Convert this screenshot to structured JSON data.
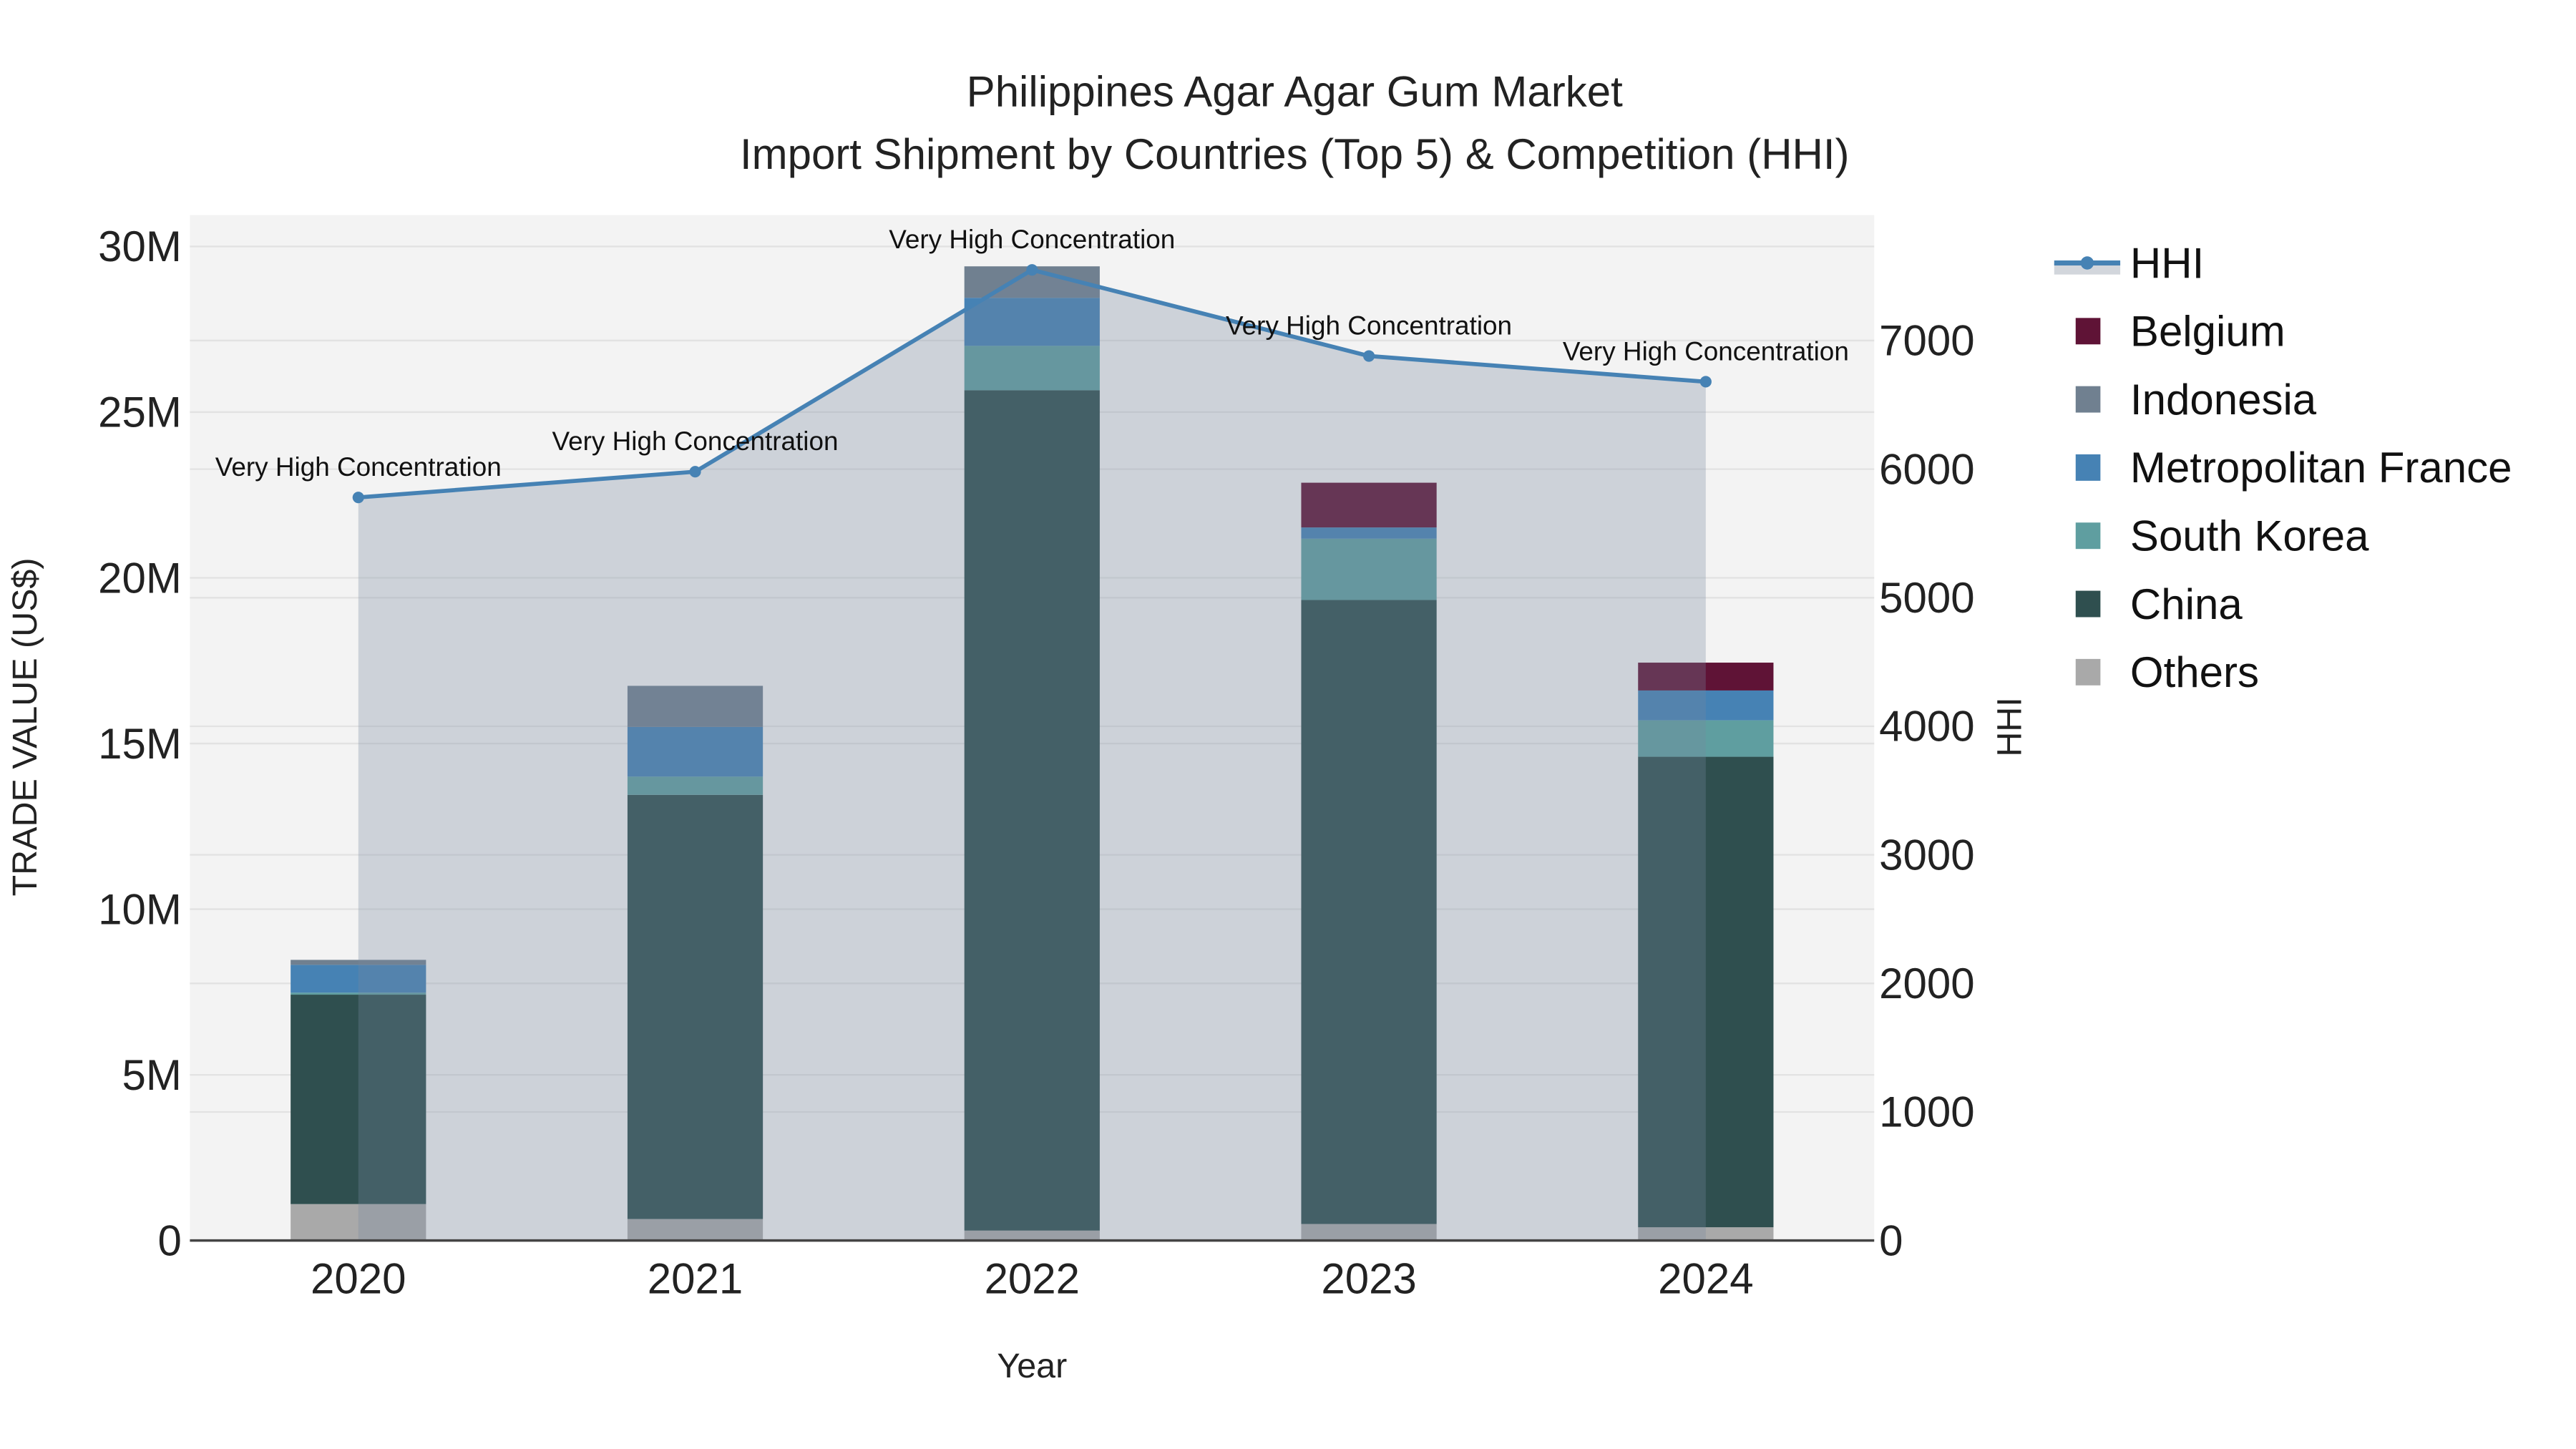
{
  "chart_data": {
    "type": "bar",
    "stacked": true,
    "title": "Philippines Agar Agar Gum Market",
    "subtitle": "Import Shipment by Countries (Top 5) & Competition (HHI)",
    "xlabel": "Year",
    "ylabel": "TRADE VALUE (US$)",
    "y2label": "HHI",
    "categories": [
      "2020",
      "2021",
      "2022",
      "2023",
      "2024"
    ],
    "ylim": [
      0,
      31000000
    ],
    "y2lim": [
      0,
      8000
    ],
    "yticks": [
      {
        "v": 0,
        "label": "0"
      },
      {
        "v": 5000000,
        "label": "5M"
      },
      {
        "v": 10000000,
        "label": "10M"
      },
      {
        "v": 15000000,
        "label": "15M"
      },
      {
        "v": 20000000,
        "label": "20M"
      },
      {
        "v": 25000000,
        "label": "25M"
      },
      {
        "v": 30000000,
        "label": "30M"
      }
    ],
    "y2ticks": [
      {
        "v": 0,
        "label": "0"
      },
      {
        "v": 1000,
        "label": "1000"
      },
      {
        "v": 2000,
        "label": "2000"
      },
      {
        "v": 3000,
        "label": "3000"
      },
      {
        "v": 4000,
        "label": "4000"
      },
      {
        "v": 5000,
        "label": "5000"
      },
      {
        "v": 6000,
        "label": "6000"
      },
      {
        "v": 7000,
        "label": "7000"
      }
    ],
    "series": [
      {
        "name": "Others",
        "color": "#a9a9a9",
        "values": [
          1100000,
          650000,
          300000,
          500000,
          400000
        ]
      },
      {
        "name": "China",
        "color": "#2f4f4f",
        "values": [
          6320000,
          12800000,
          25360000,
          18830000,
          14200000
        ]
      },
      {
        "name": "South Korea",
        "color": "#5f9ea0",
        "values": [
          60000,
          550000,
          1340000,
          1850000,
          1100000
        ]
      },
      {
        "name": "Metropolitan France",
        "color": "#4682b4",
        "values": [
          840000,
          1500000,
          1450000,
          340000,
          900000
        ]
      },
      {
        "name": "Indonesia",
        "color": "#708090",
        "values": [
          150000,
          1240000,
          950000,
          0,
          0
        ]
      },
      {
        "name": "Belgium",
        "color": "#5f1336",
        "values": [
          0,
          0,
          0,
          1350000,
          840000
        ]
      }
    ],
    "hhi": {
      "name": "HHI",
      "color": "#4682b4",
      "values": [
        5780,
        5980,
        7550,
        6880,
        6680
      ],
      "annotations": [
        "Very High Concentration",
        "Very High Concentration",
        "Very High Concentration",
        "Very High Concentration",
        "Very High Concentration"
      ]
    },
    "legend": {
      "placement": "right",
      "order": [
        "HHI",
        "Belgium",
        "Indonesia",
        "Metropolitan France",
        "South Korea",
        "China",
        "Others"
      ]
    },
    "grid": true
  }
}
